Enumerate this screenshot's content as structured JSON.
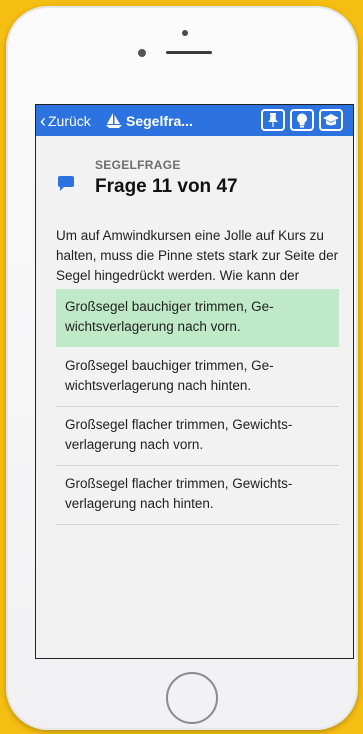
{
  "navbar": {
    "back_label": "Zurück",
    "title": "Segelfra...",
    "accent": "#2d73df",
    "buttons": [
      "pin-icon",
      "lightbulb-icon",
      "graduation-cap-icon"
    ]
  },
  "question": {
    "icon": "speech-bubble-icon",
    "label": "SEGELFRAGE",
    "title": "Frage 11 von 47",
    "text": "Um auf Amwindkursen eine Jolle auf Kurs zu halten, muss die Pinne stets stark zur Seite der Segel hingedrückt werden. Wie kann der Trimmfehler behoben werden?"
  },
  "answers": [
    {
      "text": "Großsegel bauchiger trimmen, Ge-wichtsverlagerung nach vorn.",
      "correct": true
    },
    {
      "text": "Großsegel bauchiger trimmen, Ge-wichtsverlagerung nach hinten.",
      "correct": false
    },
    {
      "text": "Großsegel flacher trimmen, Gewichts-verlagerung nach vorn.",
      "correct": false
    },
    {
      "text": "Großsegel flacher trimmen, Gewichts-verlagerung nach hinten.",
      "correct": false
    }
  ],
  "colors": {
    "correct_answer_bg": "#bfe9c7",
    "page_background": "#f5be12"
  }
}
